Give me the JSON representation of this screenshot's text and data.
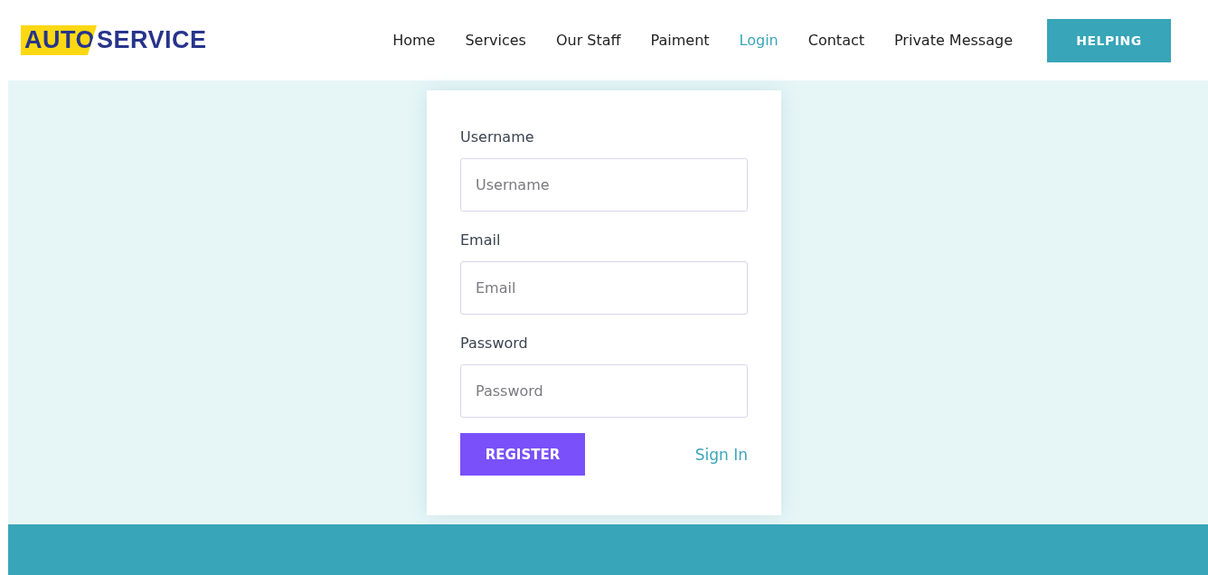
{
  "logo": {
    "highlight": "AUTO",
    "rest": "SERVICE"
  },
  "nav": [
    {
      "label": "Home",
      "selected": false
    },
    {
      "label": "Services",
      "selected": false
    },
    {
      "label": "Our Staff",
      "selected": false
    },
    {
      "label": "Paiment",
      "selected": false
    },
    {
      "label": "Login",
      "selected": true
    },
    {
      "label": "Contact",
      "selected": false
    },
    {
      "label": "Private Message",
      "selected": false
    }
  ],
  "help_button": "HELPING",
  "form": {
    "fields": [
      {
        "label": "Username",
        "placeholder": "Username"
      },
      {
        "label": "Email",
        "placeholder": "Email"
      },
      {
        "label": "Password",
        "placeholder": "Password"
      }
    ],
    "submit": "REGISTER",
    "sign_in": "Sign In"
  }
}
